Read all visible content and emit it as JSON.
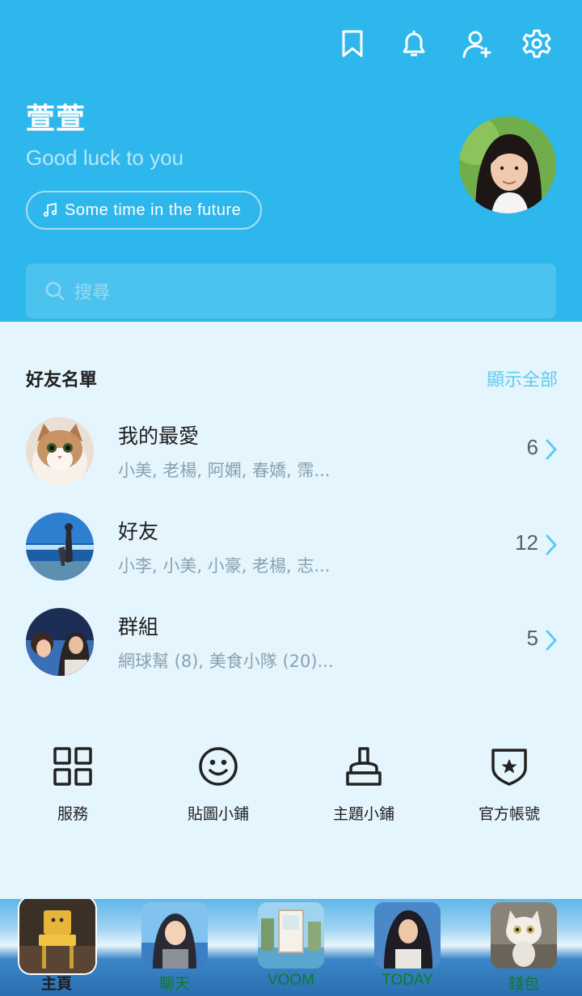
{
  "profile": {
    "name": "萱萱",
    "status": "Good luck to you",
    "music": "Some time in the future"
  },
  "top_icons": [
    "bookmark-icon",
    "bell-icon",
    "add-friend-icon",
    "gear-icon"
  ],
  "search": {
    "placeholder": "搜尋"
  },
  "friends": {
    "title": "好友名單",
    "show_all": "顯示全部",
    "groups": [
      {
        "title": "我的最愛",
        "members": "小美, 老楊, 阿嫻, 春嬌, 霈...",
        "count": "6"
      },
      {
        "title": "好友",
        "members": "小李, 小美, 小豪, 老楊, 志...",
        "count": "12"
      },
      {
        "title": "群組",
        "members": "網球幫 (8), 美食小隊 (20)...",
        "count": "5"
      }
    ]
  },
  "services": [
    {
      "label": "服務",
      "icon": "grid-icon"
    },
    {
      "label": "貼圖小鋪",
      "icon": "smiley-icon"
    },
    {
      "label": "主題小鋪",
      "icon": "brush-icon"
    },
    {
      "label": "官方帳號",
      "icon": "shield-star-icon"
    }
  ],
  "nav": [
    {
      "label": "主頁",
      "active": true
    },
    {
      "label": "聊天"
    },
    {
      "label": "VOOM"
    },
    {
      "label": "TODAY"
    },
    {
      "label": "錢包"
    }
  ],
  "colors": {
    "header": "#2eb7ec",
    "accent": "#5ccbf0",
    "nav_label": "#0e7a2c"
  }
}
